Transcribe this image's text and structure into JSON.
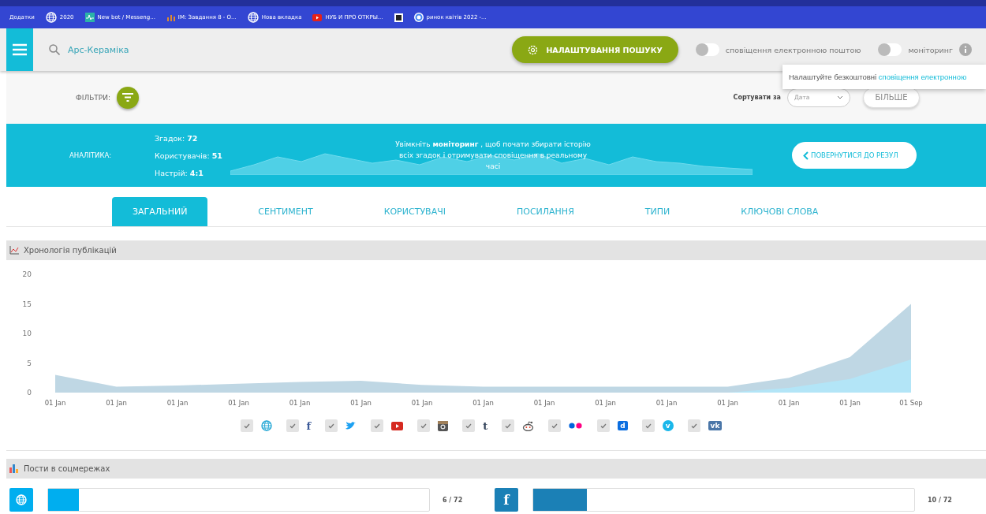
{
  "bookmarks": [
    {
      "label": "Додатки",
      "kind": "text"
    },
    {
      "label": "2020",
      "kind": "globe"
    },
    {
      "label": "New bot / Messeng...",
      "kind": "pulse"
    },
    {
      "label": "IM: Завдання 8 - О...",
      "kind": "bars"
    },
    {
      "label": "Нова вкладка",
      "kind": "globe"
    },
    {
      "label": "НУБ И ПРО ОТКРЫ...",
      "kind": "play"
    },
    {
      "kind": "square"
    },
    {
      "label": "ринок квітів 2022 -...",
      "kind": "ring"
    }
  ],
  "search": {
    "value": "Арс-Кераміка"
  },
  "search_settings_button": "НАЛАШТУВАННЯ ПОШУКУ",
  "toggles": [
    {
      "label": "сповіщення електронною поштою",
      "on": false
    },
    {
      "label": "моніторинг",
      "on": false
    }
  ],
  "tooltip": {
    "text": "Налаштуйте безкоштовні ",
    "link": "сповіщення електронною"
  },
  "filters_label": "ФІЛЬТРИ:",
  "sort": {
    "label": "Сортувати за",
    "value": "Дата"
  },
  "more_button": "БІЛЬШЕ",
  "analytics": {
    "label": "АНАЛІТИКА:",
    "stats": [
      "Згадок: **72**",
      "Користувачів: **51**",
      "Настрій: **4:1**"
    ],
    "message": "Увімкніть **моніторинг** , щоб почати збирати історію всіх згадок і отримувати сповіщення в реальному часі",
    "back_button": "ПОВЕРНУТИСЯ ДО РЕЗУЛ"
  },
  "tabs": [
    {
      "label": "ЗАГАЛЬНИЙ",
      "selected": true
    },
    {
      "label": "СЕНТИМЕНТ",
      "selected": false
    },
    {
      "label": "КОРИСТУВАЧІ",
      "selected": false
    },
    {
      "label": "ПОСИЛАННЯ",
      "selected": false
    },
    {
      "label": "ТИПИ",
      "selected": false
    },
    {
      "label": "КЛЮЧОВІ СЛОВА",
      "selected": false
    }
  ],
  "timeline": {
    "title": "Хронологія публікацій",
    "chart_data": {
      "type": "area",
      "categories": [
        "01 Jan",
        "01 Jan",
        "01 Jan",
        "01 Jan",
        "01 Jan",
        "01 Jan",
        "01 Jan",
        "01 Jan",
        "01 Jan",
        "01 Jan",
        "01 Jan",
        "01 Jan",
        "01 Jan",
        "01 Jan",
        "01 Sep"
      ],
      "ylim": [
        0,
        20
      ],
      "yticks": [
        0,
        5,
        10,
        15,
        20
      ],
      "series": [
        {
          "color": "#bfd7e4",
          "values": [
            3,
            1,
            1.2,
            1.5,
            1.8,
            2,
            1.3,
            1,
            1,
            1,
            1,
            1,
            2.5,
            6,
            15
          ]
        },
        {
          "color": "#b3e5f7",
          "values": [
            0,
            0,
            0,
            0,
            0,
            0,
            0,
            0,
            0,
            0,
            0,
            0,
            0.8,
            2.3,
            5.6
          ]
        }
      ]
    }
  },
  "networks": [
    {
      "kind": "globe",
      "color": "#29a9d6",
      "checked": true
    },
    {
      "kind": "letter",
      "glyph": "f",
      "color": "#3b5998",
      "checked": true
    },
    {
      "kind": "bird",
      "color": "#1da1f2",
      "checked": true
    },
    {
      "kind": "play",
      "color": "#d62a20",
      "checked": true
    },
    {
      "kind": "camera",
      "color": "#555555",
      "checked": true
    },
    {
      "kind": "letter",
      "glyph": "t",
      "color": "#36465d",
      "checked": true
    },
    {
      "kind": "alien",
      "color": "#555555",
      "checked": true
    },
    {
      "kind": "dots",
      "color": "#0063dc",
      "checked": true
    },
    {
      "kind": "badge",
      "glyph": "d",
      "color": "#0b6ee0",
      "checked": true
    },
    {
      "kind": "circle",
      "glyph": "v",
      "color": "#1ab7ea",
      "checked": true
    },
    {
      "kind": "badge",
      "glyph": "vk",
      "color": "#4a76a8",
      "checked": true
    }
  ],
  "posts": {
    "title": "Пости в соцмережах",
    "rows": [
      {
        "kind": "globe",
        "color": "#00aeef",
        "level": 0.08,
        "reading": "6 / 72"
      },
      {
        "kind": "letter",
        "glyph": "f",
        "color": "#1b80b6",
        "level": 0.14,
        "reading": "10 / 72"
      }
    ]
  }
}
